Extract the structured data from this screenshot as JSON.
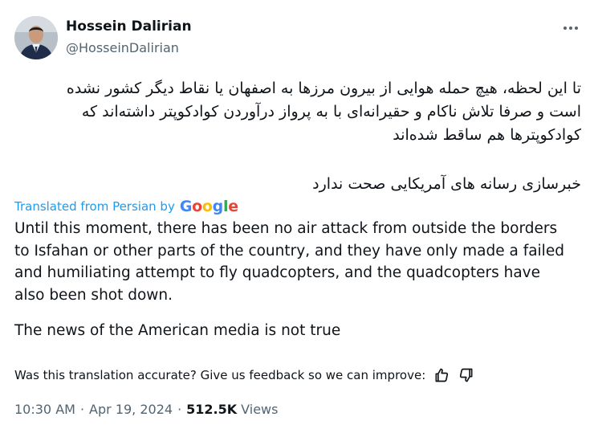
{
  "author": {
    "name": "Hossein Dalirian",
    "handle": "@HosseinDalirian"
  },
  "tweet": {
    "persian_lines": [
      "تا این لحظه، هیچ حمله هوایی از بیرون مرزها به اصفهان یا نقاط دیگر کشور نشده",
      "است و صرفا تلاش ناکام و حقیرانه‌ای با به پرواز درآوردن کوادکوپتر داشته‌اند که",
      "کوادکوپترها هم ساقط شده‌اند"
    ],
    "persian_second": "خبرسازی رسانه های آمریکایی صحت ندارد",
    "translated_label": "Translated from Persian by",
    "translated_provider": "Google",
    "english_lines": [
      "Until this moment, there has been no air attack from outside the borders",
      "to Isfahan or other parts of the country, and they have only made a failed",
      "and humiliating attempt to fly quadcopters, and the quadcopters have",
      "also been shot down."
    ],
    "english_second": "The news of the American media is not true",
    "feedback_prompt": "Was this translation accurate? Give us feedback so we can improve:"
  },
  "meta": {
    "time": "10:30 AM",
    "separator": "·",
    "date": "Apr 19, 2024",
    "views_count": "512.5K",
    "views_label": "Views"
  },
  "colors": {
    "link_blue": "#1d9bf0",
    "text": "#0f1419",
    "secondary": "#536471",
    "google_blue": "#4285F4",
    "google_red": "#EA4335",
    "google_yellow": "#FBBC05",
    "google_green": "#34A853"
  },
  "icons": {
    "more": "more-horizontal-icon",
    "like": "thumbs-up-icon",
    "dislike": "thumbs-down-icon"
  }
}
